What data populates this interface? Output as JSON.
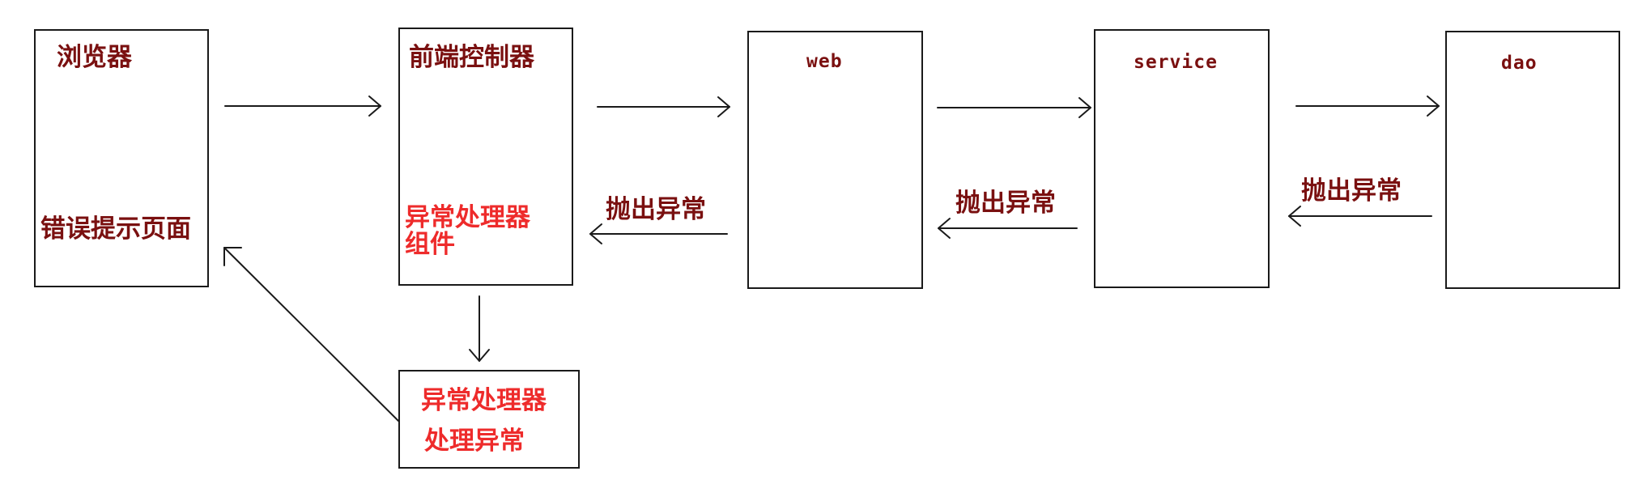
{
  "colors": {
    "dark_label": "#7a1010",
    "red_label": "#ee2b2b",
    "line": "#1a1a1a"
  },
  "browser": {
    "title": "浏览器",
    "error_page": "错误提示页面"
  },
  "front_controller": {
    "title": "前端控制器",
    "handler_component_line1": "异常处理器",
    "handler_component_line2": "组件"
  },
  "web": {
    "title": "web"
  },
  "service": {
    "title": "service"
  },
  "dao": {
    "title": "dao"
  },
  "exception_handler": {
    "line1": "异常处理器",
    "line2": "处理异常"
  },
  "throw_labels": {
    "web_to_controller": "抛出异常",
    "service_to_web": "抛出异常",
    "dao_to_service": "抛出异常"
  }
}
